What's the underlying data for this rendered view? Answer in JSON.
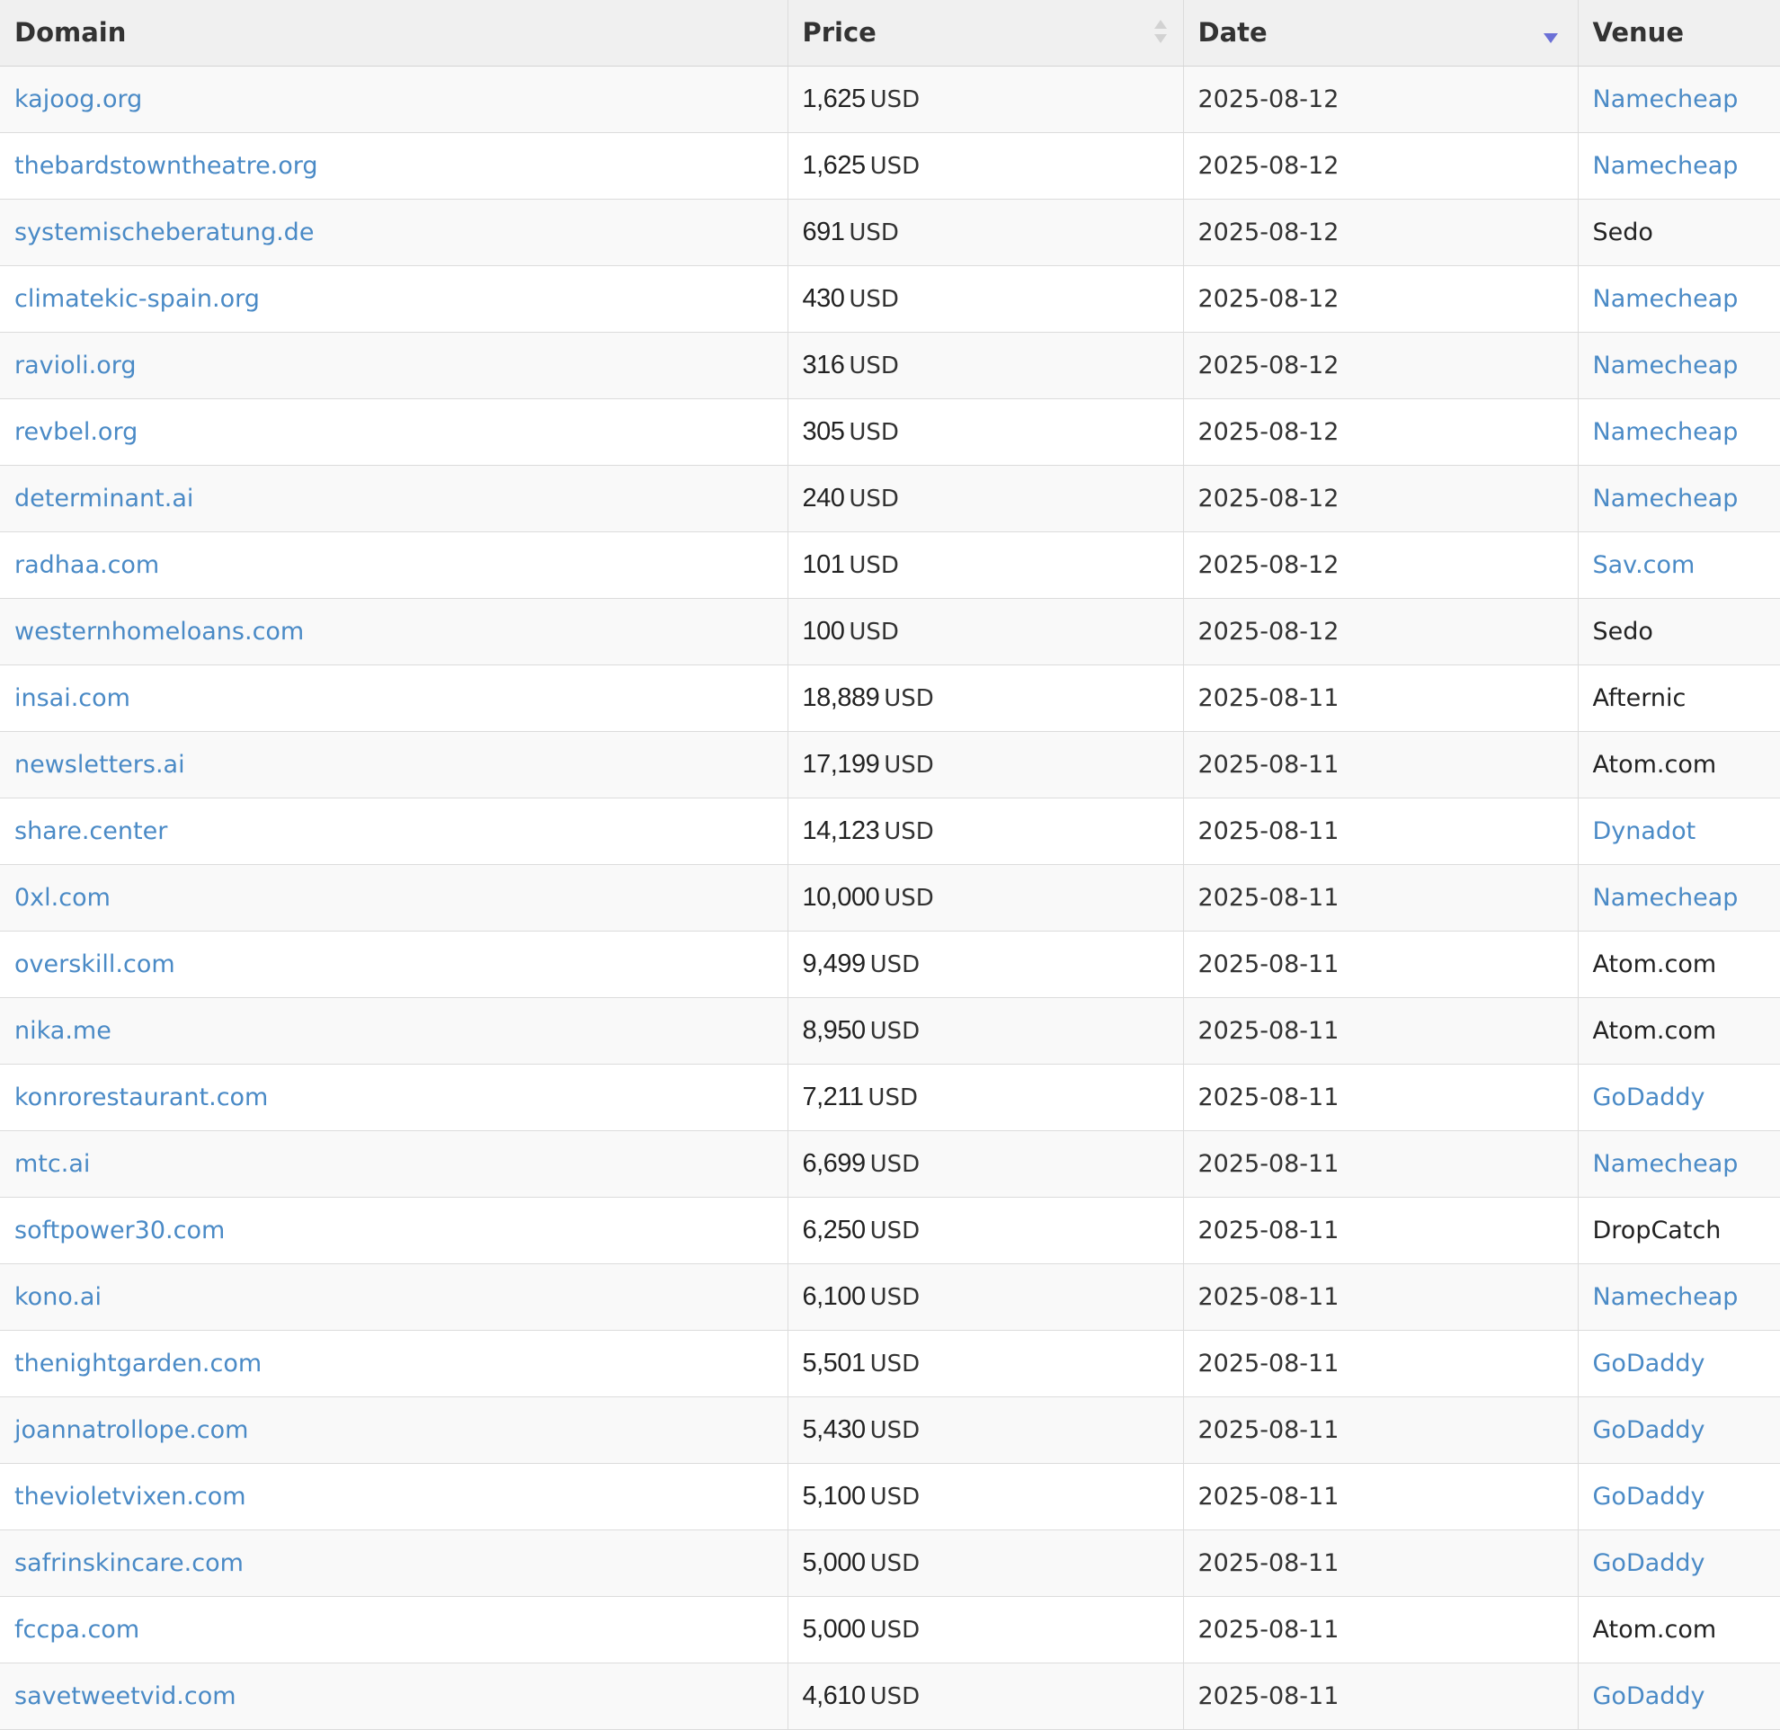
{
  "columns": {
    "domain": "Domain",
    "price": "Price",
    "date": "Date",
    "venue": "Venue"
  },
  "sort": {
    "column": "date",
    "direction": "descending"
  },
  "colors": {
    "link": "#4a8ac6",
    "sort_active": "#6b70d6",
    "header_bg": "#f0f0f0",
    "stripe_bg": "#f9f9f9"
  },
  "rows": [
    {
      "domain": "kajoog.org",
      "amount": "1,625",
      "currency": "USD",
      "date": "2025-08-12",
      "venue": "Namecheap",
      "venue_linked": true
    },
    {
      "domain": "thebardstowntheatre.org",
      "amount": "1,625",
      "currency": "USD",
      "date": "2025-08-12",
      "venue": "Namecheap",
      "venue_linked": true
    },
    {
      "domain": "systemischeberatung.de",
      "amount": "691",
      "currency": "USD",
      "date": "2025-08-12",
      "venue": "Sedo",
      "venue_linked": false
    },
    {
      "domain": "climatekic-spain.org",
      "amount": "430",
      "currency": "USD",
      "date": "2025-08-12",
      "venue": "Namecheap",
      "venue_linked": true
    },
    {
      "domain": "ravioli.org",
      "amount": "316",
      "currency": "USD",
      "date": "2025-08-12",
      "venue": "Namecheap",
      "venue_linked": true
    },
    {
      "domain": "revbel.org",
      "amount": "305",
      "currency": "USD",
      "date": "2025-08-12",
      "venue": "Namecheap",
      "venue_linked": true
    },
    {
      "domain": "determinant.ai",
      "amount": "240",
      "currency": "USD",
      "date": "2025-08-12",
      "venue": "Namecheap",
      "venue_linked": true
    },
    {
      "domain": "radhaa.com",
      "amount": "101",
      "currency": "USD",
      "date": "2025-08-12",
      "venue": "Sav.com",
      "venue_linked": true
    },
    {
      "domain": "westernhomeloans.com",
      "amount": "100",
      "currency": "USD",
      "date": "2025-08-12",
      "venue": "Sedo",
      "venue_linked": false
    },
    {
      "domain": "insai.com",
      "amount": "18,889",
      "currency": "USD",
      "date": "2025-08-11",
      "venue": "Afternic",
      "venue_linked": false
    },
    {
      "domain": "newsletters.ai",
      "amount": "17,199",
      "currency": "USD",
      "date": "2025-08-11",
      "venue": "Atom.com",
      "venue_linked": false
    },
    {
      "domain": "share.center",
      "amount": "14,123",
      "currency": "USD",
      "date": "2025-08-11",
      "venue": "Dynadot",
      "venue_linked": true
    },
    {
      "domain": "0xl.com",
      "amount": "10,000",
      "currency": "USD",
      "date": "2025-08-11",
      "venue": "Namecheap",
      "venue_linked": true
    },
    {
      "domain": "overskill.com",
      "amount": "9,499",
      "currency": "USD",
      "date": "2025-08-11",
      "venue": "Atom.com",
      "venue_linked": false
    },
    {
      "domain": "nika.me",
      "amount": "8,950",
      "currency": "USD",
      "date": "2025-08-11",
      "venue": "Atom.com",
      "venue_linked": false
    },
    {
      "domain": "konrorestaurant.com",
      "amount": "7,211",
      "currency": "USD",
      "date": "2025-08-11",
      "venue": "GoDaddy",
      "venue_linked": true
    },
    {
      "domain": "mtc.ai",
      "amount": "6,699",
      "currency": "USD",
      "date": "2025-08-11",
      "venue": "Namecheap",
      "venue_linked": true
    },
    {
      "domain": "softpower30.com",
      "amount": "6,250",
      "currency": "USD",
      "date": "2025-08-11",
      "venue": "DropCatch",
      "venue_linked": false
    },
    {
      "domain": "kono.ai",
      "amount": "6,100",
      "currency": "USD",
      "date": "2025-08-11",
      "venue": "Namecheap",
      "venue_linked": true
    },
    {
      "domain": "thenightgarden.com",
      "amount": "5,501",
      "currency": "USD",
      "date": "2025-08-11",
      "venue": "GoDaddy",
      "venue_linked": true
    },
    {
      "domain": "joannatrollope.com",
      "amount": "5,430",
      "currency": "USD",
      "date": "2025-08-11",
      "venue": "GoDaddy",
      "venue_linked": true
    },
    {
      "domain": "thevioletvixen.com",
      "amount": "5,100",
      "currency": "USD",
      "date": "2025-08-11",
      "venue": "GoDaddy",
      "venue_linked": true
    },
    {
      "domain": "safrinskincare.com",
      "amount": "5,000",
      "currency": "USD",
      "date": "2025-08-11",
      "venue": "GoDaddy",
      "venue_linked": true
    },
    {
      "domain": "fccpa.com",
      "amount": "5,000",
      "currency": "USD",
      "date": "2025-08-11",
      "venue": "Atom.com",
      "venue_linked": false
    },
    {
      "domain": "savetweetvid.com",
      "amount": "4,610",
      "currency": "USD",
      "date": "2025-08-11",
      "venue": "GoDaddy",
      "venue_linked": true
    }
  ]
}
